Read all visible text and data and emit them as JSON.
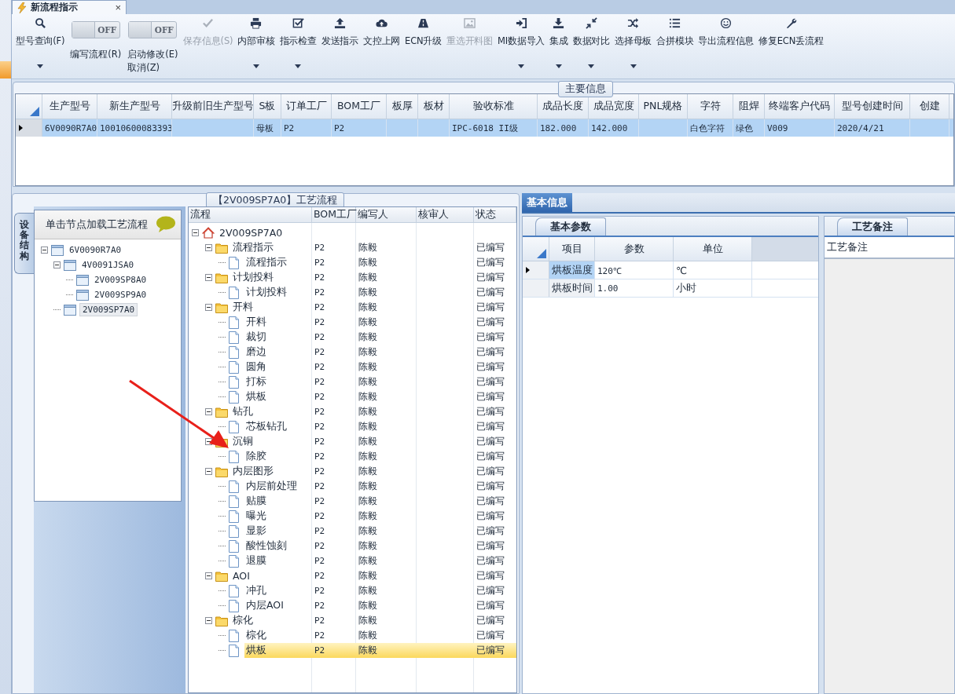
{
  "document_tab": {
    "title": "新流程指示",
    "close": "×"
  },
  "toolbar": [
    {
      "kind": "button",
      "label": "型号查询(F)",
      "disabled": false,
      "dropdown": true
    },
    {
      "kind": "toggle",
      "on": false,
      "state_text": "OFF",
      "labels": [
        "编写流程(R)"
      ]
    },
    {
      "kind": "toggle",
      "on": false,
      "state_text": "OFF",
      "labels": [
        "启动修改(E)",
        "取消(Z)"
      ]
    },
    {
      "kind": "button",
      "label": "保存信息(S)",
      "disabled": true,
      "dropdown": false
    },
    {
      "kind": "button",
      "label": "内部审核",
      "disabled": false,
      "dropdown": true
    },
    {
      "kind": "button",
      "label": "指示检查",
      "disabled": false,
      "dropdown": true
    },
    {
      "kind": "button",
      "label": "发送指示",
      "disabled": false,
      "dropdown": false
    },
    {
      "kind": "button",
      "label": "文控上网",
      "disabled": false,
      "dropdown": false
    },
    {
      "kind": "button",
      "label": "ECN升级",
      "disabled": false,
      "dropdown": false
    },
    {
      "kind": "button",
      "label": "重选开料图",
      "disabled": true,
      "dropdown": false
    },
    {
      "kind": "button",
      "label": "MI数据导入",
      "disabled": false,
      "dropdown": true
    },
    {
      "kind": "button",
      "label": "集成",
      "disabled": false,
      "dropdown": true
    },
    {
      "kind": "button",
      "label": "数据对比",
      "disabled": false,
      "dropdown": true
    },
    {
      "kind": "button",
      "label": "选择母板",
      "disabled": false,
      "dropdown": true
    },
    {
      "kind": "button",
      "label": "合拼模块",
      "disabled": false,
      "dropdown": false
    },
    {
      "kind": "button",
      "label": "导出流程信息",
      "disabled": false,
      "dropdown": false
    },
    {
      "kind": "button",
      "label": "修复ECN丢流程",
      "disabled": false,
      "dropdown": false
    }
  ],
  "main_info": {
    "title": "主要信息",
    "columns": [
      "生产型号",
      "新生产型号",
      "升级前旧生产型号",
      "S板",
      "订单工厂",
      "BOM工厂",
      "板厚",
      "板材",
      "验收标准",
      "成品长度",
      "成品宽度",
      "PNL规格",
      "字符",
      "阻焊",
      "终端客户代码",
      "型号创建时间",
      "创建"
    ],
    "rows": [
      {
        "selected": true,
        "cells": [
          "6V0090R7A0",
          "10010600083393",
          null,
          "母板",
          "P2",
          "P2",
          null,
          null,
          "IPC-6018 II级",
          "182.000",
          "142.000",
          null,
          "白色字符",
          "绿色",
          "V009",
          "2020/4/21",
          null
        ]
      }
    ]
  },
  "process_panel": {
    "title": "【2V009SP7A0】工艺流程"
  },
  "equipment": {
    "side_tab": "设备结构",
    "header": "单击节点加载工艺流程",
    "tree": [
      {
        "label": "6V0090R7A0",
        "expanded": true,
        "selected": false,
        "children": [
          {
            "label": "4V0091JSA0",
            "expanded": true,
            "selected": false,
            "children": [
              {
                "label": "2V009SP8A0",
                "selected": false
              },
              {
                "label": "2V009SP9A0",
                "selected": false
              }
            ]
          },
          {
            "label": "2V009SP7A0",
            "selected": true
          }
        ]
      }
    ]
  },
  "flow": {
    "columns": [
      "流程",
      "BOM工厂",
      "编写人",
      "核审人",
      "状态"
    ],
    "tree": [
      {
        "kind": "root",
        "name": "2V009SP7A0",
        "expanded": true,
        "selected": false,
        "children": [
          {
            "kind": "folder",
            "name": "流程指示",
            "bom": "P2",
            "writer": "陈毅",
            "status": "已编写",
            "expanded": true,
            "selected": false,
            "children": [
              {
                "kind": "file",
                "name": "流程指示",
                "bom": "P2",
                "writer": "陈毅",
                "status": "已编写",
                "selected": false
              }
            ]
          },
          {
            "kind": "folder",
            "name": "计划投料",
            "bom": "P2",
            "writer": "陈毅",
            "status": "已编写",
            "expanded": true,
            "selected": false,
            "children": [
              {
                "kind": "file",
                "name": "计划投料",
                "bom": "P2",
                "writer": "陈毅",
                "status": "已编写",
                "selected": false
              }
            ]
          },
          {
            "kind": "folder",
            "name": "开料",
            "bom": "P2",
            "writer": "陈毅",
            "status": "已编写",
            "expanded": true,
            "selected": false,
            "children": [
              {
                "kind": "file",
                "name": "开料",
                "bom": "P2",
                "writer": "陈毅",
                "status": "已编写",
                "selected": false
              },
              {
                "kind": "file",
                "name": "裁切",
                "bom": "P2",
                "writer": "陈毅",
                "status": "已编写",
                "selected": false
              },
              {
                "kind": "file",
                "name": "磨边",
                "bom": "P2",
                "writer": "陈毅",
                "status": "已编写",
                "selected": false
              },
              {
                "kind": "file",
                "name": "圆角",
                "bom": "P2",
                "writer": "陈毅",
                "status": "已编写",
                "selected": false
              },
              {
                "kind": "file",
                "name": "打标",
                "bom": "P2",
                "writer": "陈毅",
                "status": "已编写",
                "selected": false
              },
              {
                "kind": "file",
                "name": "烘板",
                "bom": "P2",
                "writer": "陈毅",
                "status": "已编写",
                "selected": false
              }
            ]
          },
          {
            "kind": "folder",
            "name": "钻孔",
            "bom": "P2",
            "writer": "陈毅",
            "status": "已编写",
            "expanded": true,
            "selected": false,
            "children": [
              {
                "kind": "file",
                "name": "芯板钻孔",
                "bom": "P2",
                "writer": "陈毅",
                "status": "已编写",
                "selected": false
              }
            ]
          },
          {
            "kind": "folder",
            "name": "沉铜",
            "bom": "P2",
            "writer": "陈毅",
            "status": "已编写",
            "expanded": true,
            "selected": false,
            "children": [
              {
                "kind": "file",
                "name": "除胶",
                "bom": "P2",
                "writer": "陈毅",
                "status": "已编写",
                "selected": false
              }
            ]
          },
          {
            "kind": "folder",
            "name": "内层图形",
            "bom": "P2",
            "writer": "陈毅",
            "status": "已编写",
            "expanded": true,
            "selected": false,
            "children": [
              {
                "kind": "file",
                "name": "内层前处理",
                "bom": "P2",
                "writer": "陈毅",
                "status": "已编写",
                "selected": false
              },
              {
                "kind": "file",
                "name": "贴膜",
                "bom": "P2",
                "writer": "陈毅",
                "status": "已编写",
                "selected": false
              },
              {
                "kind": "file",
                "name": "曝光",
                "bom": "P2",
                "writer": "陈毅",
                "status": "已编写",
                "selected": false
              },
              {
                "kind": "file",
                "name": "显影",
                "bom": "P2",
                "writer": "陈毅",
                "status": "已编写",
                "selected": false
              },
              {
                "kind": "file",
                "name": "酸性蚀刻",
                "bom": "P2",
                "writer": "陈毅",
                "status": "已编写",
                "selected": false
              },
              {
                "kind": "file",
                "name": "退膜",
                "bom": "P2",
                "writer": "陈毅",
                "status": "已编写",
                "selected": false
              }
            ]
          },
          {
            "kind": "folder",
            "name": "AOI",
            "bom": "P2",
            "writer": "陈毅",
            "status": "已编写",
            "expanded": true,
            "selected": false,
            "children": [
              {
                "kind": "file",
                "name": "冲孔",
                "bom": "P2",
                "writer": "陈毅",
                "status": "已编写",
                "selected": false
              },
              {
                "kind": "file",
                "name": "内层AOI",
                "bom": "P2",
                "writer": "陈毅",
                "status": "已编写",
                "selected": false
              }
            ]
          },
          {
            "kind": "folder",
            "name": "棕化",
            "bom": "P2",
            "writer": "陈毅",
            "status": "已编写",
            "expanded": true,
            "selected": false,
            "children": [
              {
                "kind": "file",
                "name": "棕化",
                "bom": "P2",
                "writer": "陈毅",
                "status": "已编写",
                "selected": false
              },
              {
                "kind": "file",
                "name": "烘板",
                "bom": "P2",
                "writer": "陈毅",
                "status": "已编写",
                "selected": true
              }
            ]
          }
        ]
      }
    ]
  },
  "detail_tabs": [
    {
      "label": "基本信息",
      "selected": true
    }
  ],
  "params": {
    "tab": {
      "label": "基本参数",
      "selected": true
    },
    "columns": [
      "项目",
      "参数",
      "单位"
    ],
    "rows": [
      {
        "selected": true,
        "cells": [
          "烘板温度",
          "120℃",
          "℃"
        ]
      },
      {
        "selected": false,
        "cells": [
          "烘板时间",
          "1.00",
          "小时"
        ]
      }
    ]
  },
  "notes": {
    "tab": {
      "label": "工艺备注",
      "selected": true
    },
    "label": "工艺备注"
  }
}
